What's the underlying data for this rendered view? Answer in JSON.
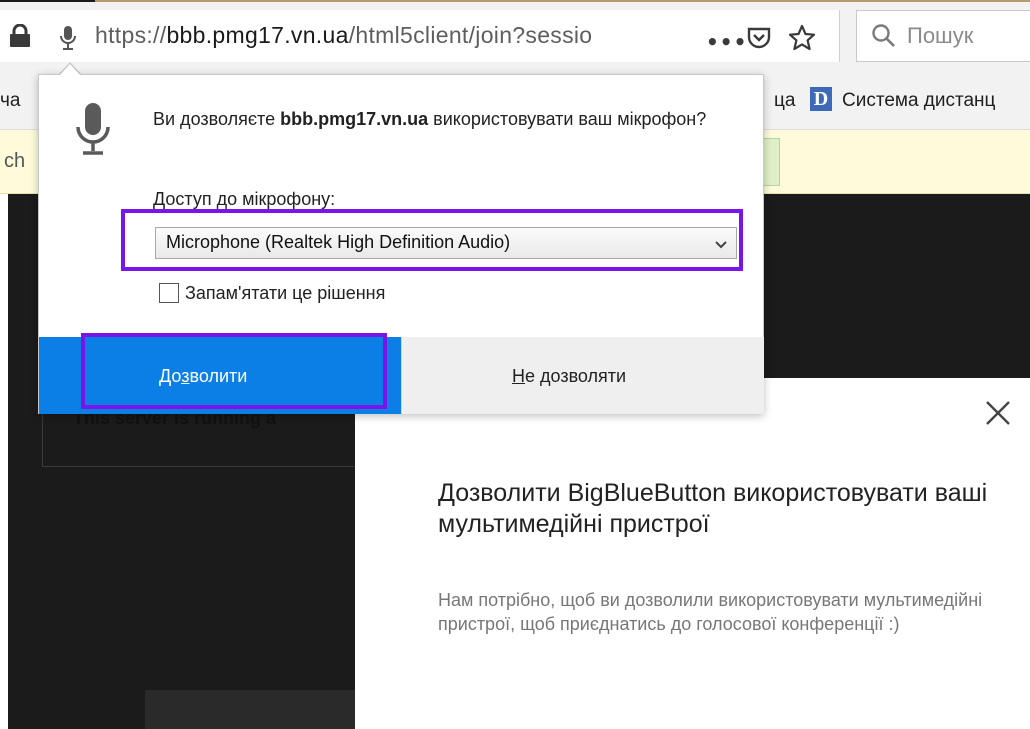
{
  "browser": {
    "url_host": "bbb.pmg17.vn.ua",
    "url_prefix": "https://",
    "url_suffix": "/html5client/join?sessio",
    "page_actions": "•••",
    "search_placeholder": "Пошук",
    "icons": [
      "lock-icon",
      "microphone-permission-icon",
      "pocket-icon",
      "bookmark-star-icon",
      "search-icon"
    ]
  },
  "bookmarks": {
    "left_fragment": "ча",
    "mid_fragment": "ца",
    "favicon_letter": "D",
    "right_label": "Система дистанц"
  },
  "notification": {
    "text_fragment": "ch"
  },
  "page": {
    "server_text_fragment": "This server is running a"
  },
  "permission_popup": {
    "question_prefix": "Ви дозволяєте ",
    "question_host": "bbb.pmg17.vn.ua",
    "question_suffix": " використовувати ваш мікрофон?",
    "access_label": "Доступ до мікрофону:",
    "selected_device": "Microphone (Realtek High Definition Audio)",
    "remember_label": "Запам'ятати це рішення",
    "remember_checked": false,
    "allow_prefix": "До",
    "allow_accel": "з",
    "allow_suffix": "волити",
    "deny_accel": "Н",
    "deny_suffix": "е дозволяти",
    "highlight_color": "#7a15e8",
    "allow_color": "#0b7fe6"
  },
  "modal": {
    "title": "Дозволити BigBlueButton використовувати ваші мультимедійні пристрої",
    "description": "Нам потрібно, щоб ви дозволили використовувати мультимедійні пристрої, щоб приєднатись до голосової конференції :)"
  }
}
